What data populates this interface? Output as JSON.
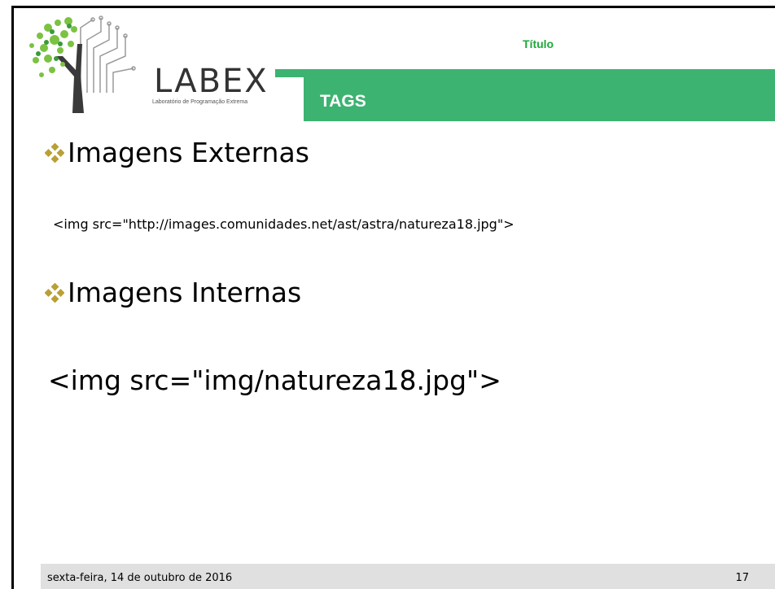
{
  "logo": {
    "word": "LABEX",
    "subtitle": "Laboratório de Programação Extrema"
  },
  "header": {
    "title": "Título",
    "section": "TAGS"
  },
  "content": {
    "bullet1": "Imagens Externas",
    "code1": "<img src=\"http://images.comunidades.net/ast/astra/natureza18.jpg\">",
    "bullet2": "Imagens Internas",
    "code2": "<img src=\"img/natureza18.jpg\">"
  },
  "footer": {
    "date": "sexta-feira, 14 de outubro de 2016",
    "page": "17"
  },
  "colors": {
    "accent_green": "#3cb371",
    "title_green": "#1ea83a",
    "bullet_gold": "#b8a035",
    "footer_bg": "#e0e0e0"
  }
}
